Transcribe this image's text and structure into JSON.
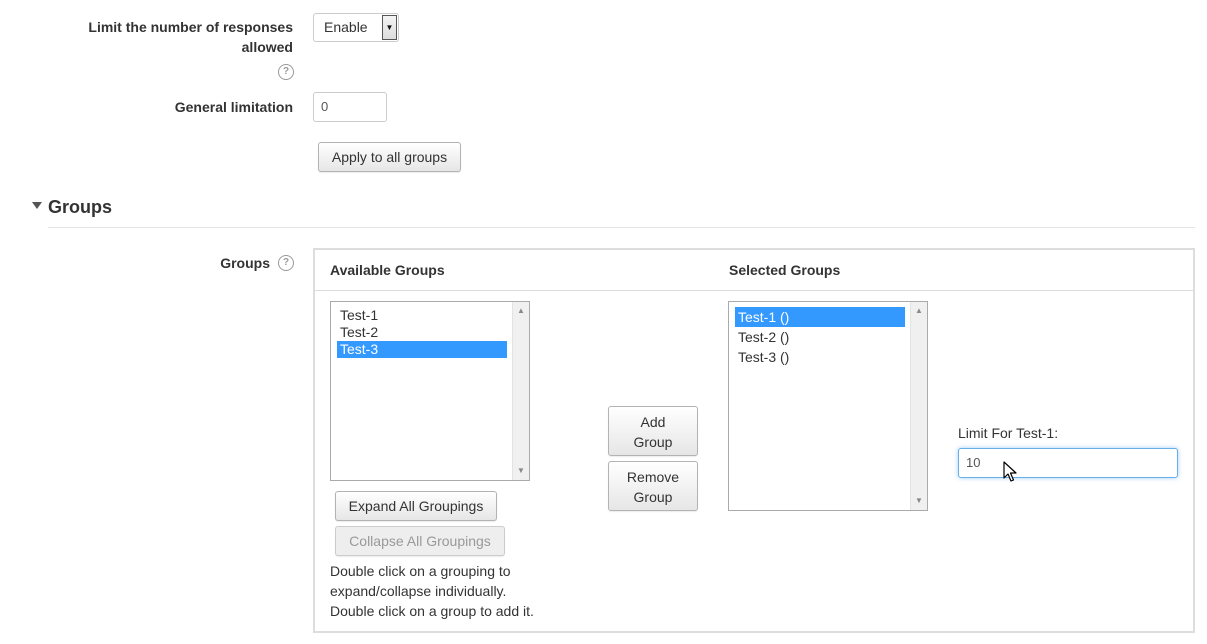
{
  "limit": {
    "label": "Limit the number of responses allowed",
    "select_value": "Enable"
  },
  "general": {
    "label": "General limitation",
    "value": "0"
  },
  "apply_label": "Apply to all groups",
  "section": {
    "title": "Groups"
  },
  "groups": {
    "label": "Groups",
    "available_header": "Available Groups",
    "selected_header": "Selected Groups",
    "available_items": [
      "Test-1",
      "Test-2",
      "Test-3"
    ],
    "selected_items": [
      "Test-1 ()",
      "Test-2 ()",
      "Test-3 ()"
    ],
    "add_label": "Add Group",
    "remove_label": "Remove Group",
    "expand_label": "Expand All Groupings",
    "collapse_label": "Collapse All Groupings",
    "help_text_1": "Double click on a grouping to expand/collapse individually.",
    "help_text_2": "Double click on a group to add it.",
    "limit_label": "Limit For Test-1:",
    "limit_value": "10"
  },
  "colors": {
    "selection": "#3399ff",
    "focus_border": "#66afe9"
  },
  "icons": [
    "help-icon",
    "collapse-triangle-icon",
    "mouse-cursor-icon",
    "scroll-up-icon",
    "scroll-down-icon",
    "dropdown-arrow-icon"
  ]
}
